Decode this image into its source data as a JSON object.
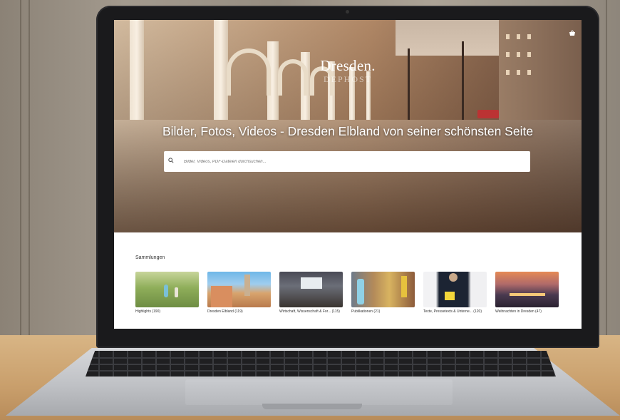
{
  "site": {
    "logo": "Dresden.",
    "logo_sub": "DEPHOST",
    "headline": "Bilder, Fotos, Videos - Dresden Elbland von seiner schönsten Seite",
    "cart_icon": "shopping-basket-icon"
  },
  "search": {
    "placeholder": "Bilder, Videos, PDF-Dateien durchsuchen...",
    "icon": "search-icon"
  },
  "collections": {
    "title": "Sammlungen",
    "items": [
      {
        "label": "Highlights (190)"
      },
      {
        "label": "Dresden Elbland (119)"
      },
      {
        "label": "Wirtschaft, Wissenschaft & For... (115)"
      },
      {
        "label": "Publikationen (21)"
      },
      {
        "label": "Texte, Pressetexts & Unterne... (120)"
      },
      {
        "label": "Weihnachten in Dresden (47)"
      }
    ]
  },
  "colors": {
    "accent": "#ffffff",
    "frame": "#1a1a1c"
  }
}
